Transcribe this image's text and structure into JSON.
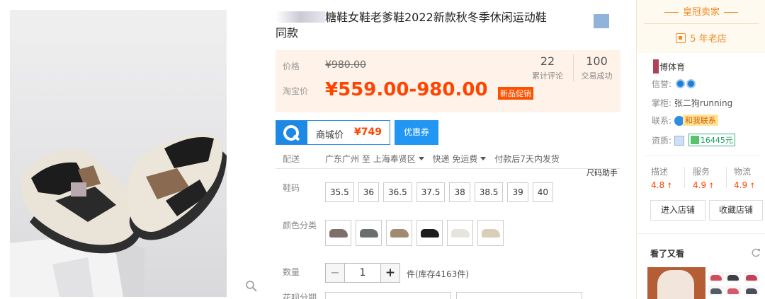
{
  "title": {
    "text": "糖鞋女鞋老爹鞋2022新款秋冬季休闲运动鞋",
    "line2": "同款"
  },
  "price": {
    "orig_label": "价格",
    "orig_value": "¥980.00",
    "promo_label": "淘宝价",
    "promo_value": "¥559.00-980.00",
    "promo_tag": "新品促销",
    "reviews_count": "22",
    "reviews_label": "累计评论",
    "deals_count": "100",
    "deals_label": "交易成功"
  },
  "tmall": {
    "label": "商城价",
    "price": "¥749",
    "coupon_button": "优惠券"
  },
  "shipping": {
    "label": "配送",
    "from": "广东广州",
    "to_word": "至",
    "dest": "上海奉贤区",
    "method": "快递 免运费",
    "note": "付款后7天内发货",
    "size_helper": "尺码助手"
  },
  "size": {
    "label": "鞋码",
    "options": [
      "35.5",
      "36",
      "36.5",
      "37.5",
      "38",
      "38.5",
      "39",
      "40"
    ]
  },
  "color": {
    "label": "颜色分类",
    "swatches": [
      "#7d6f6a",
      "#6b6e6f",
      "#a08a72",
      "#1c1c1c",
      "#e7e4dc",
      "#d9cfb8"
    ]
  },
  "quantity": {
    "label": "数量",
    "minus": "−",
    "value": "1",
    "plus": "+",
    "stock": "件(库存4163件)"
  },
  "installment": {
    "label": "花呗分期"
  },
  "shop": {
    "level": "皇冠卖家",
    "years": "5 年老店",
    "name": "博体育",
    "credit_label": "信誉:",
    "keeper_label": "掌柜:",
    "keeper": "张二狗running",
    "contact_label": "联系:",
    "contact_badge": "和我联系",
    "qual_label": "资质:",
    "qual_amount": "16445元",
    "scores": [
      {
        "label": "描述",
        "value": "4.8"
      },
      {
        "label": "服务",
        "value": "4.9"
      },
      {
        "label": "物流",
        "value": "4.9"
      }
    ],
    "enter_button": "进入店铺",
    "fav_button": "收藏店铺",
    "also_title": "看了又看"
  },
  "colors": {
    "accent": "#ff4400",
    "tmall_blue": "#2196f3",
    "crown_orange": "#f08a24"
  }
}
